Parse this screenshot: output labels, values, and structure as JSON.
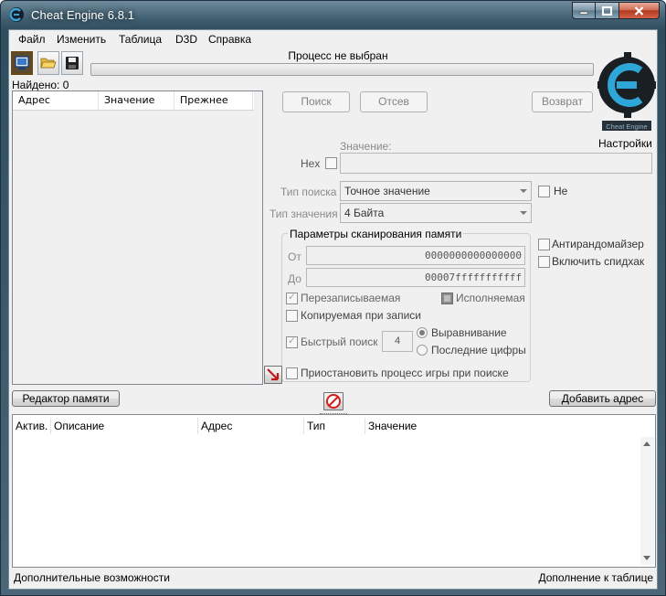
{
  "window": {
    "title": "Cheat Engine 6.8.1"
  },
  "menu": {
    "items": [
      "Файл",
      "Изменить",
      "Таблица",
      "D3D",
      "Справка"
    ]
  },
  "process": {
    "label": "Процесс не выбран",
    "found": "Найдено: 0"
  },
  "results": {
    "columns": [
      "Адрес",
      "Значение",
      "Прежнее"
    ]
  },
  "scan": {
    "first_scan": "Поиск",
    "next_scan": "Отсев",
    "undo_scan": "Возврат",
    "settings": "Настройки",
    "logo_text": "Cheat Engine",
    "value_label": "Значение:",
    "hex_label": "Hex",
    "scan_type_label": "Тип поиска",
    "scan_type_value": "Точное значение",
    "not_label": "Не",
    "value_type_label": "Тип значения",
    "value_type_value": "4 Байта",
    "memory_group_title": "Параметры сканирования памяти",
    "from_label": "От",
    "from_value": "0000000000000000",
    "to_label": "До",
    "to_value": "00007fffffffffff",
    "writable": "Перезаписываемая",
    "executable": "Исполняемая",
    "copy_on_write": "Копируемая при записи",
    "fast_scan": "Быстрый поиск",
    "fast_scan_value": "4",
    "alignment": "Выравнивание",
    "last_digits": "Последние цифры",
    "pause_game": "Приостановить процесс игры при поиске",
    "antirandomizer": "Антирандомайзер",
    "speedhack": "Включить спидхак"
  },
  "actions": {
    "memory_view": "Редактор памяти",
    "add_address": "Добавить адрес"
  },
  "address_list": {
    "columns": [
      "Актив.",
      "Описание",
      "Адрес",
      "Тип",
      "Значение"
    ]
  },
  "footer": {
    "left": "Дополнительные возможности",
    "right": "Дополнение к таблице"
  },
  "colors": {
    "title_bar": "#3f5e70",
    "close_button": "#c8452b",
    "client_bg": "#f0f0f0"
  }
}
